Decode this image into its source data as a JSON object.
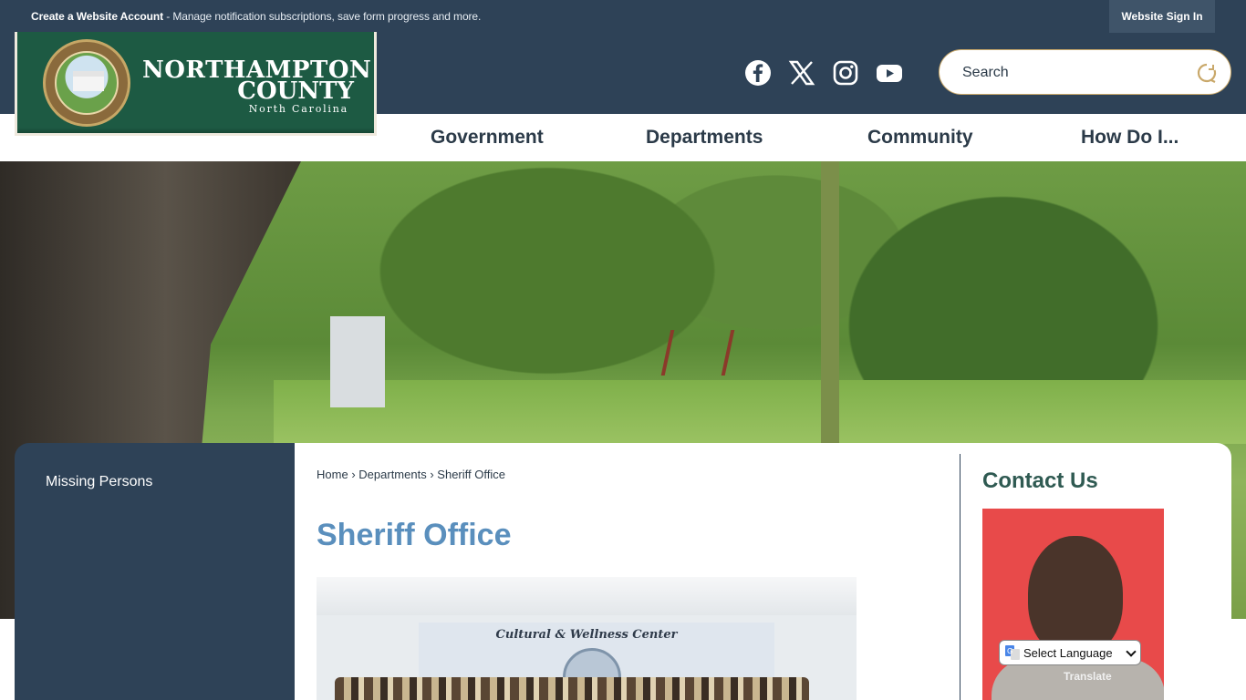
{
  "topbar": {
    "account_bold": "Create a Website Account",
    "account_rest": " - Manage notification subscriptions, save form progress and more.",
    "signin_label": "Website Sign In"
  },
  "logo": {
    "line1": "NORTHAMPTON",
    "line2": "COUNTY",
    "line3": "North Carolina"
  },
  "social": [
    "facebook-icon",
    "x-icon",
    "instagram-icon",
    "youtube-icon"
  ],
  "search": {
    "placeholder": "Search"
  },
  "nav": {
    "items": [
      "Government",
      "Departments",
      "Community",
      "How Do I..."
    ]
  },
  "sidebar": {
    "items": [
      "Missing Persons"
    ]
  },
  "breadcrumb": {
    "home": "Home",
    "departments": "Departments",
    "current": "Sheriff Office",
    "sep": "›"
  },
  "page": {
    "title": "Sheriff Office",
    "photo_banner": "Cultural & Wellness Center"
  },
  "contact": {
    "title": "Contact Us"
  },
  "translate": {
    "select_label": "Select Language",
    "powered": "Translate"
  },
  "colors": {
    "navy": "#2e4257",
    "title_blue": "#5a8fbd",
    "contact_green": "#2f5a52",
    "logo_green": "#1d5a43",
    "gold": "#c9a86a"
  }
}
